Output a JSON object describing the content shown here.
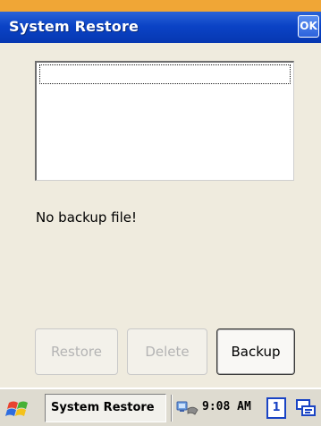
{
  "window": {
    "title": "System Restore",
    "ok_label": "OK"
  },
  "main": {
    "status_message": "No backup file!",
    "buttons": {
      "restore_label": "Restore",
      "delete_label": "Delete",
      "backup_label": "Backup"
    }
  },
  "taskbar": {
    "start_icon": "windows-flag-icon",
    "task_label": "System Restore",
    "network_icon": "network-connection-icon",
    "clock": "9:08 AM",
    "desktop_number": "1",
    "input_panel_icon": "input-panel-icon"
  },
  "colors": {
    "titlebar": "#0b43c6",
    "top_accent": "#f0a636",
    "background": "#efebde",
    "disabled_text": "#b4b4b4"
  }
}
